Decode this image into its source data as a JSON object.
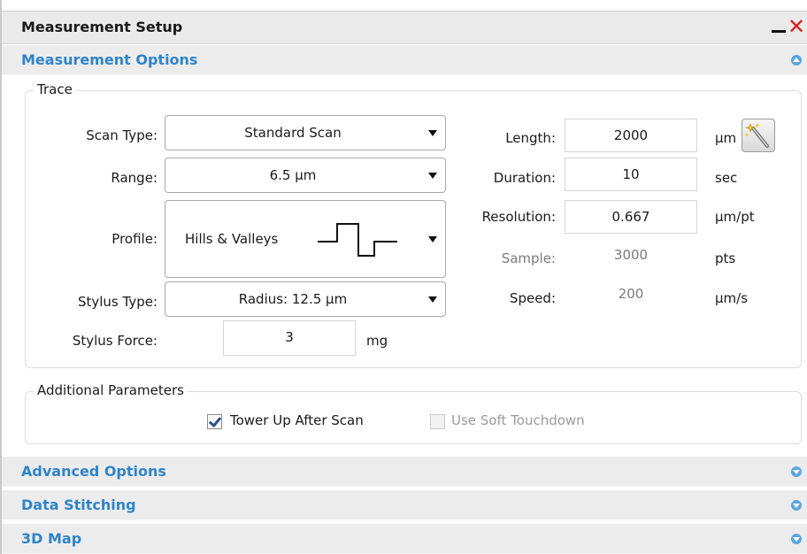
{
  "window": {
    "title": "Measurement Setup",
    "minimize_icon": "minimize-icon",
    "close_icon": "close-icon",
    "close_color": "#e01a1a"
  },
  "accent_color": "#2f84c8",
  "sections": {
    "measurement_options": {
      "label": "Measurement Options",
      "state": "expanded"
    },
    "advanced_options": {
      "label": "Advanced Options",
      "state": "collapsed"
    },
    "data_stitching": {
      "label": "Data Stitching",
      "state": "collapsed"
    },
    "map_3d": {
      "label": "3D Map",
      "state": "collapsed"
    }
  },
  "trace": {
    "legend": "Trace",
    "scan_type": {
      "label": "Scan Type:",
      "value": "Standard Scan"
    },
    "range": {
      "label": "Range:",
      "value": "6.5 µm"
    },
    "profile": {
      "label": "Profile:",
      "value": "Hills & Valleys",
      "icon": "hills-valleys-profile-icon"
    },
    "stylus_type": {
      "label": "Stylus Type:",
      "value": "Radius: 12.5 µm"
    },
    "stylus_force": {
      "label": "Stylus Force:",
      "value": "3",
      "unit": "mg"
    },
    "length": {
      "label": "Length:",
      "value": "2000",
      "unit": "µm",
      "button_icon": "magic-wand-icon"
    },
    "duration": {
      "label": "Duration:",
      "value": "10",
      "unit": "sec"
    },
    "resolution": {
      "label": "Resolution:",
      "value": "0.667",
      "unit": "µm/pt"
    },
    "sample": {
      "label": "Sample:",
      "value": "3000",
      "unit": "pts"
    },
    "speed": {
      "label": "Speed:",
      "value": "200",
      "unit": "µm/s"
    }
  },
  "additional": {
    "legend": "Additional Parameters",
    "tower_up": {
      "label": "Tower Up After Scan",
      "checked": true,
      "enabled": true
    },
    "soft_touchdown": {
      "label": "Use Soft Touchdown",
      "checked": false,
      "enabled": false
    }
  }
}
